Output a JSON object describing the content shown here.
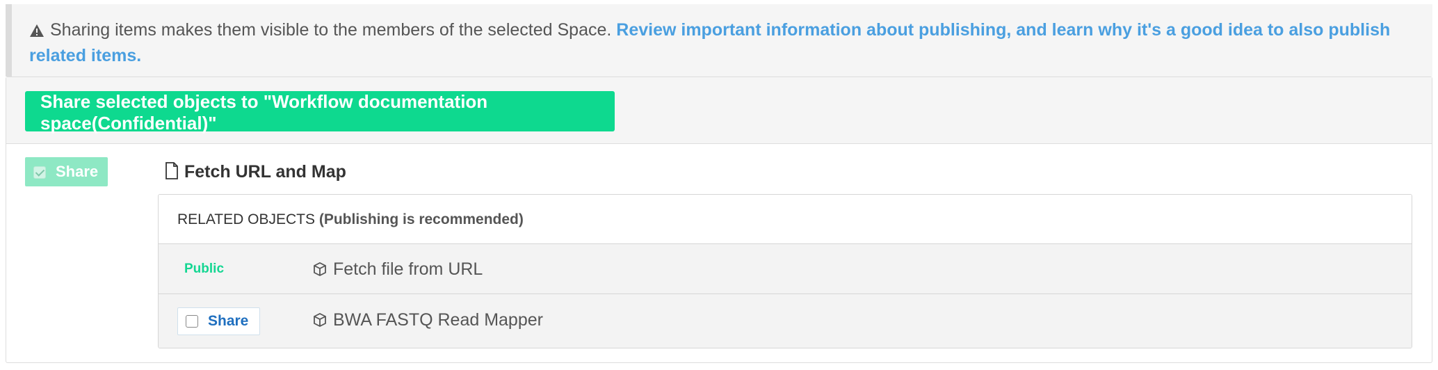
{
  "notice": {
    "icon": "warning-icon",
    "text": "Sharing items makes them visible to the members of the selected Space. ",
    "link": "Review important information about publishing, and learn why it's a good idea to also publish related items."
  },
  "actions": {
    "share_all_label": "Share selected objects to \"Workflow documentation space(Confidential)\""
  },
  "main_object": {
    "share_label": "Share",
    "share_checked": true,
    "icon": "document-icon",
    "title": "Fetch URL and Map"
  },
  "related": {
    "heading": "RELATED OBJECTS",
    "subheading": "(Publishing is recommended)",
    "items": [
      {
        "status": "Public",
        "icon": "cube-icon",
        "name": "Fetch file from URL"
      },
      {
        "share_label": "Share",
        "share_checked": false,
        "icon": "cube-icon",
        "name": "BWA FASTQ Read Mapper"
      }
    ]
  },
  "colors": {
    "accent_green": "#0ed98f",
    "link_blue": "#4a9fe0",
    "share_blue": "#1f6fbf"
  }
}
